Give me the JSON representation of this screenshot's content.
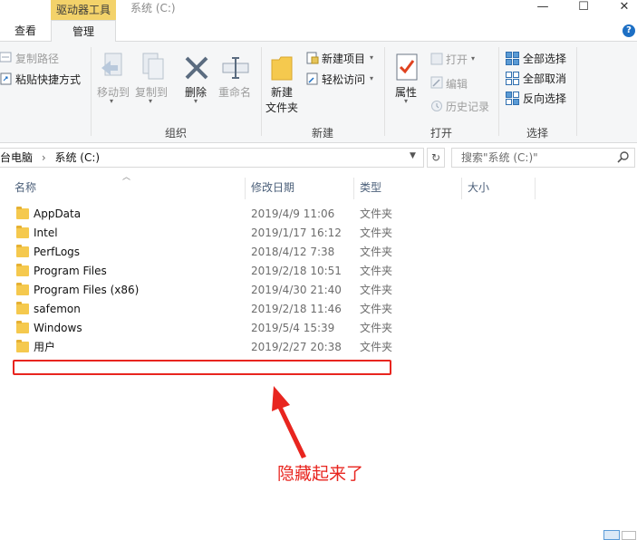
{
  "titlebar": {
    "context_tab": "驱动器工具",
    "window_title": "系统 (C:)",
    "minimize": "—",
    "maximize": "☐",
    "close": "✕"
  },
  "tabs": {
    "view": "查看",
    "manage": "管理",
    "help": "?"
  },
  "ribbon": {
    "copy_path": "复制路径",
    "paste_shortcut": "粘贴快捷方式",
    "move_to": "移动到",
    "copy_to": "复制到",
    "delete": "删除",
    "rename": "重命名",
    "new_folder_line1": "新建",
    "new_folder_line2": "文件夹",
    "new_item": "新建项目",
    "easy_access": "轻松访问",
    "properties": "属性",
    "open": "打开",
    "edit": "编辑",
    "history": "历史记录",
    "select_all": "全部选择",
    "select_none": "全部取消",
    "invert_selection": "反向选择",
    "groups": {
      "organize": "组织",
      "new": "新建",
      "open": "打开",
      "select": "选择"
    }
  },
  "address": {
    "path_root": "台电脑",
    "path_sep": "›",
    "path_current": "系统 (C:)",
    "search_placeholder": "搜索\"系统 (C:)\""
  },
  "columns": {
    "name": "名称",
    "modified": "修改日期",
    "type": "类型",
    "size": "大小"
  },
  "files": [
    {
      "name": "AppData",
      "modified": "2019/4/9 11:06",
      "type": "文件夹"
    },
    {
      "name": "Intel",
      "modified": "2019/1/17 16:12",
      "type": "文件夹"
    },
    {
      "name": "PerfLogs",
      "modified": "2018/4/12 7:38",
      "type": "文件夹"
    },
    {
      "name": "Program Files",
      "modified": "2019/2/18 10:51",
      "type": "文件夹"
    },
    {
      "name": "Program Files (x86)",
      "modified": "2019/4/30 21:40",
      "type": "文件夹"
    },
    {
      "name": "safemon",
      "modified": "2019/2/18 11:46",
      "type": "文件夹"
    },
    {
      "name": "Windows",
      "modified": "2019/5/4 15:39",
      "type": "文件夹"
    },
    {
      "name": "用户",
      "modified": "2019/2/27 20:38",
      "type": "文件夹"
    }
  ],
  "annotation": {
    "text": "隐藏起来了",
    "color": "#e8251f"
  },
  "colors": {
    "accent": "#1d6fc4",
    "context_tab": "#f3d26a",
    "folder": "#f5c94e"
  }
}
